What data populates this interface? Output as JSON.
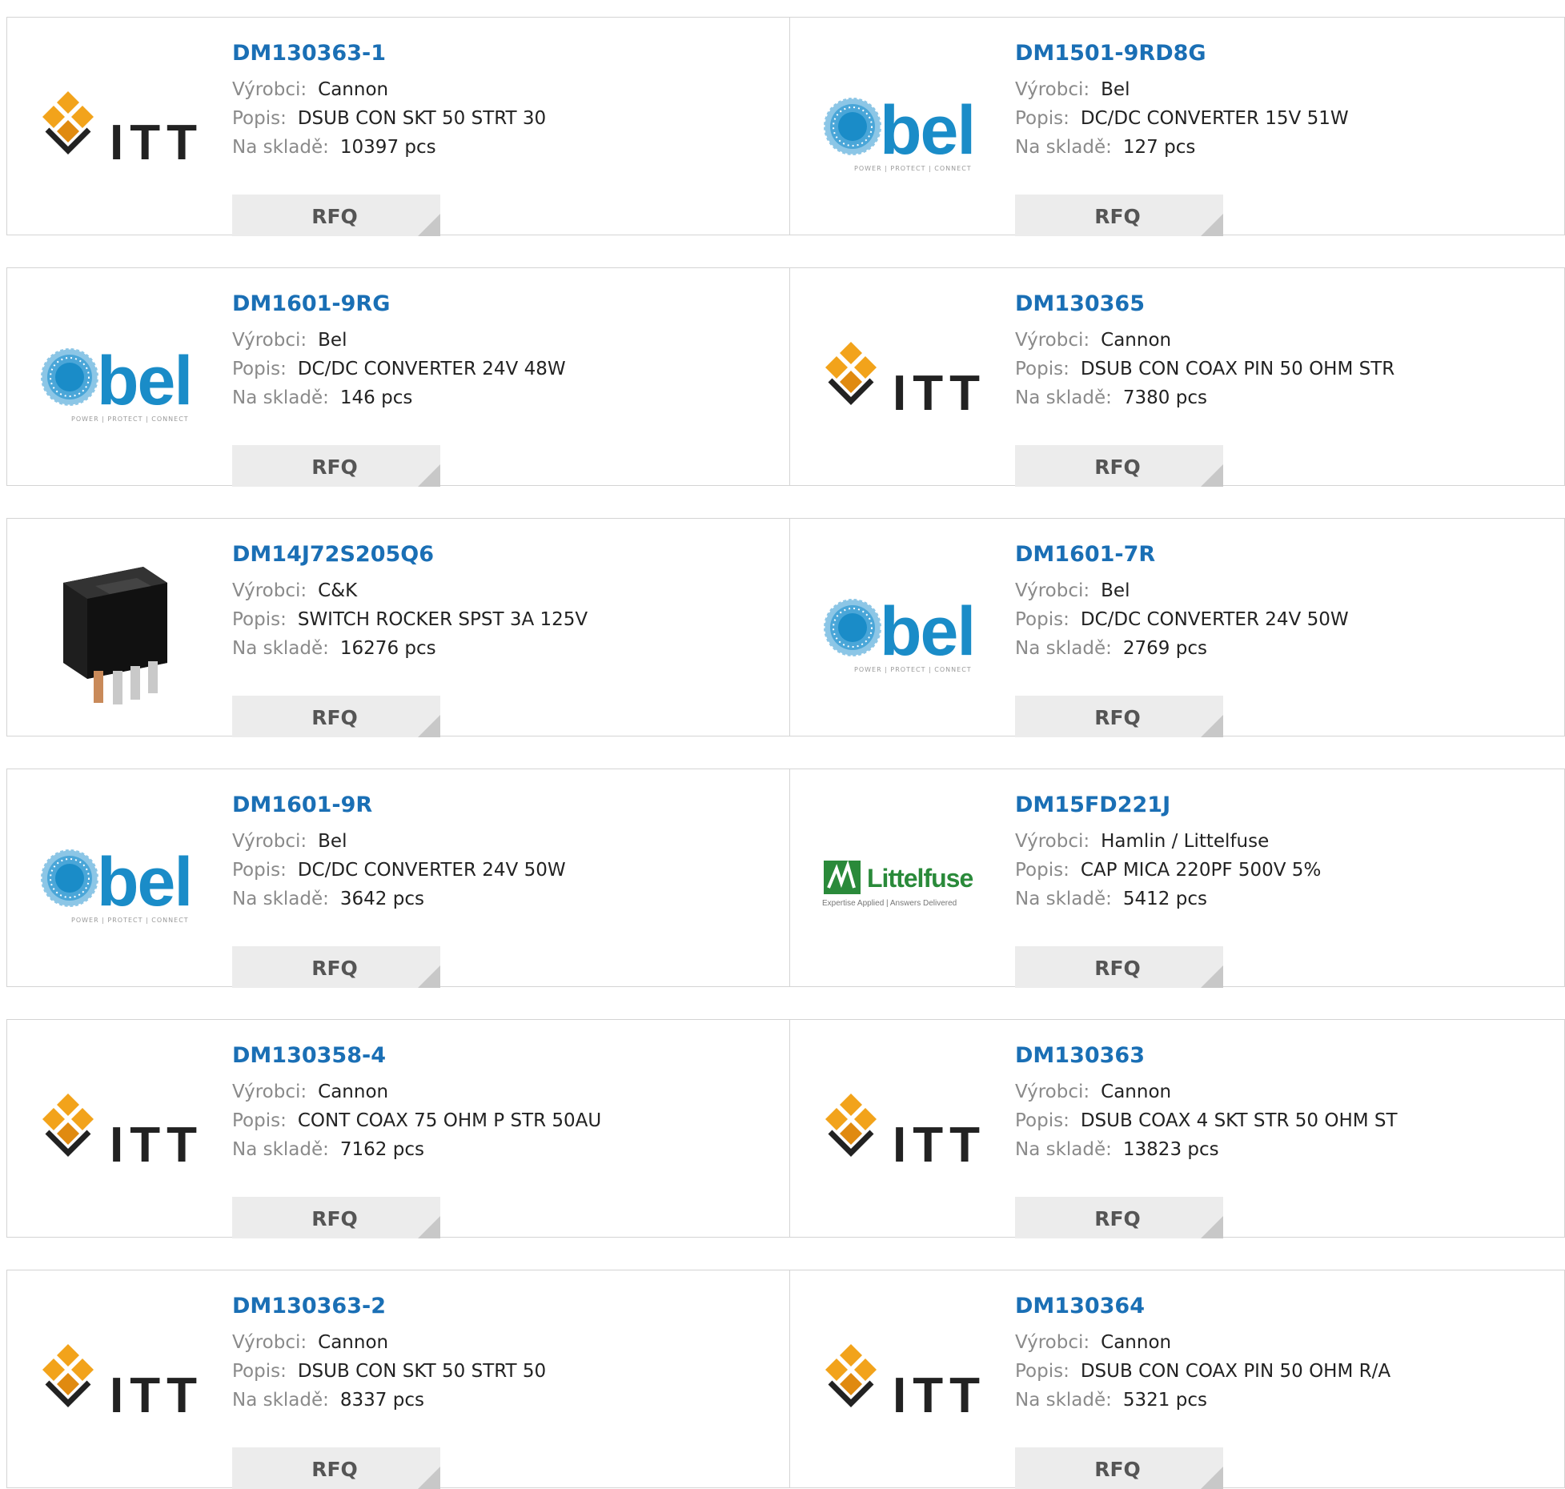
{
  "labels": {
    "manufacturer": "Výrobci:",
    "description": "Popis:",
    "stock": "Na skladě:",
    "rfq": "RFQ"
  },
  "products": [
    {
      "part": "DM130363-1",
      "manufacturer": "Cannon",
      "description": "DSUB CON SKT 50 STRT 30",
      "stock": "10397 pcs",
      "logo": "itt-logo"
    },
    {
      "part": "DM1501-9RD8G",
      "manufacturer": "Bel",
      "description": "DC/DC CONVERTER 15V 51W",
      "stock": "127 pcs",
      "logo": "bel-logo"
    },
    {
      "part": "DM1601-9RG",
      "manufacturer": "Bel",
      "description": "DC/DC CONVERTER 24V 48W",
      "stock": "146 pcs",
      "logo": "bel-logo"
    },
    {
      "part": "DM130365",
      "manufacturer": "Cannon",
      "description": "DSUB CON COAX PIN 50 OHM STR",
      "stock": "7380 pcs",
      "logo": "itt-logo"
    },
    {
      "part": "DM14J72S205Q6",
      "manufacturer": "C&K",
      "description": "SWITCH ROCKER SPST 3A 125V",
      "stock": "16276 pcs",
      "logo": "rocker-switch-photo"
    },
    {
      "part": "DM1601-7R",
      "manufacturer": "Bel",
      "description": "DC/DC CONVERTER 24V 50W",
      "stock": "2769 pcs",
      "logo": "bel-logo"
    },
    {
      "part": "DM1601-9R",
      "manufacturer": "Bel",
      "description": "DC/DC CONVERTER 24V 50W",
      "stock": "3642 pcs",
      "logo": "bel-logo"
    },
    {
      "part": "DM15FD221J",
      "manufacturer": "Hamlin / Littelfuse",
      "description": "CAP MICA 220PF 500V 5%",
      "stock": "5412 pcs",
      "logo": "littelfuse-logo"
    },
    {
      "part": "DM130358-4",
      "manufacturer": "Cannon",
      "description": "CONT COAX 75 OHM P STR 50AU",
      "stock": "7162 pcs",
      "logo": "itt-logo"
    },
    {
      "part": "DM130363",
      "manufacturer": "Cannon",
      "description": "DSUB COAX 4 SKT STR 50 OHM ST",
      "stock": "13823 pcs",
      "logo": "itt-logo"
    },
    {
      "part": "DM130363-2",
      "manufacturer": "Cannon",
      "description": "DSUB CON SKT 50 STRT 50",
      "stock": "8337 pcs",
      "logo": "itt-logo"
    },
    {
      "part": "DM130364",
      "manufacturer": "Cannon",
      "description": "DSUB CON COAX PIN 50 OHM R/A",
      "stock": "5321 pcs",
      "logo": "itt-logo"
    }
  ],
  "logo_text": {
    "itt": "ITT",
    "bel": "bel",
    "bel_tag": "POWER | PROTECT | CONNECT",
    "littelfuse": "Littelfuse",
    "littelfuse_tag": "Expertise Applied | Answers Delivered"
  },
  "colors": {
    "part_link": "#1a6fb5",
    "label": "#8a8a8a",
    "button_bg": "#ececec",
    "border": "#d4d4d4",
    "itt_orange": "#f2a31b",
    "bel_blue": "#1a8cc8",
    "littelfuse_green": "#2a8a3a"
  }
}
